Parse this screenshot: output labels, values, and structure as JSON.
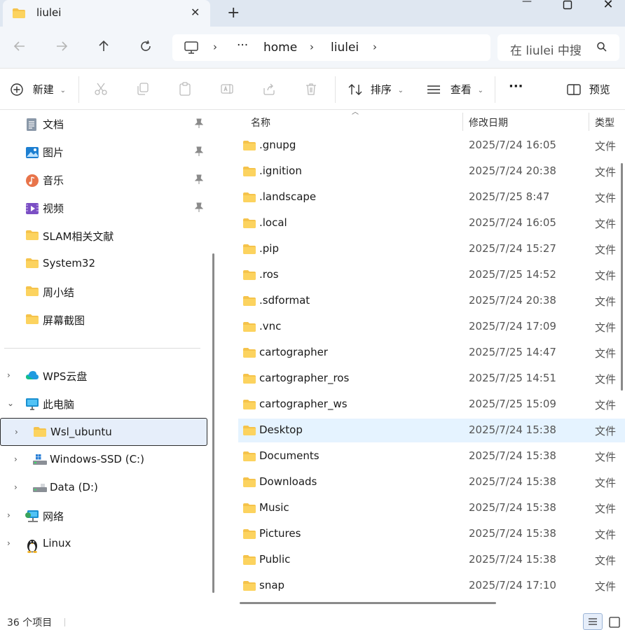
{
  "window": {
    "tab_title": "liulei",
    "new_tab": "+",
    "minimize": "—",
    "maximize": "☐",
    "close": "✕"
  },
  "address_bar": {
    "overflow": "···",
    "crumbs": [
      "home",
      "liulei"
    ],
    "search_placeholder": "在 liulei 中搜"
  },
  "toolbar": {
    "new_label": "新建",
    "sort_label": "排序",
    "view_label": "查看",
    "more_label": "···",
    "preview_label": "预览"
  },
  "sidebar": {
    "quick_access": [
      {
        "label": "文档",
        "icon": "documents-icon",
        "pinned": true
      },
      {
        "label": "图片",
        "icon": "pictures-icon",
        "pinned": true
      },
      {
        "label": "音乐",
        "icon": "music-icon",
        "pinned": true
      },
      {
        "label": "视频",
        "icon": "videos-icon",
        "pinned": true
      },
      {
        "label": "SLAM相关文献",
        "icon": "folder-icon",
        "pinned": false
      },
      {
        "label": "System32",
        "icon": "folder-icon",
        "pinned": false
      },
      {
        "label": "周小结",
        "icon": "folder-icon",
        "pinned": false
      },
      {
        "label": "屏幕截图",
        "icon": "folder-icon",
        "pinned": false
      }
    ],
    "tree": [
      {
        "label": "WPS云盘",
        "icon": "cloud-icon",
        "expander": "›",
        "indent": 0
      },
      {
        "label": "此电脑",
        "icon": "this-pc-icon",
        "expander": "⌄",
        "indent": 0
      },
      {
        "label": "Wsl_ubuntu",
        "icon": "folder-icon",
        "expander": "›",
        "indent": 1,
        "selected": true
      },
      {
        "label": "Windows-SSD (C:)",
        "icon": "windows-drive-icon",
        "expander": "›",
        "indent": 1
      },
      {
        "label": "Data (D:)",
        "icon": "drive-icon",
        "expander": "›",
        "indent": 1
      },
      {
        "label": "网络",
        "icon": "network-icon",
        "expander": "›",
        "indent": 0
      },
      {
        "label": "Linux",
        "icon": "linux-penguin-icon",
        "expander": "›",
        "indent": 0
      }
    ]
  },
  "file_list": {
    "columns": {
      "name": "名称",
      "date": "修改日期",
      "type": "类型"
    },
    "rows": [
      {
        "name": ".gnupg",
        "date": "2025/7/24 16:05",
        "type": "文件"
      },
      {
        "name": ".ignition",
        "date": "2025/7/24 20:38",
        "type": "文件"
      },
      {
        "name": ".landscape",
        "date": "2025/7/25 8:47",
        "type": "文件"
      },
      {
        "name": ".local",
        "date": "2025/7/24 16:05",
        "type": "文件"
      },
      {
        "name": ".pip",
        "date": "2025/7/24 15:27",
        "type": "文件"
      },
      {
        "name": ".ros",
        "date": "2025/7/25 14:52",
        "type": "文件"
      },
      {
        "name": ".sdformat",
        "date": "2025/7/24 20:38",
        "type": "文件"
      },
      {
        "name": ".vnc",
        "date": "2025/7/24 17:09",
        "type": "文件"
      },
      {
        "name": "cartographer",
        "date": "2025/7/25 14:47",
        "type": "文件"
      },
      {
        "name": "cartographer_ros",
        "date": "2025/7/25 14:51",
        "type": "文件"
      },
      {
        "name": "cartographer_ws",
        "date": "2025/7/25 15:09",
        "type": "文件"
      },
      {
        "name": "Desktop",
        "date": "2025/7/24 15:38",
        "type": "文件",
        "highlight": true
      },
      {
        "name": "Documents",
        "date": "2025/7/24 15:38",
        "type": "文件"
      },
      {
        "name": "Downloads",
        "date": "2025/7/24 15:38",
        "type": "文件"
      },
      {
        "name": "Music",
        "date": "2025/7/24 15:38",
        "type": "文件"
      },
      {
        "name": "Pictures",
        "date": "2025/7/24 15:38",
        "type": "文件"
      },
      {
        "name": "Public",
        "date": "2025/7/24 15:38",
        "type": "文件"
      },
      {
        "name": "snap",
        "date": "2025/7/24 17:10",
        "type": "文件"
      }
    ]
  },
  "status_bar": {
    "item_count": "36 个项目"
  },
  "colors": {
    "folder": "#f5c34b",
    "folder_dark": "#e0a82e",
    "selection": "#e5f3ff",
    "chrome": "#dfe7f1"
  }
}
